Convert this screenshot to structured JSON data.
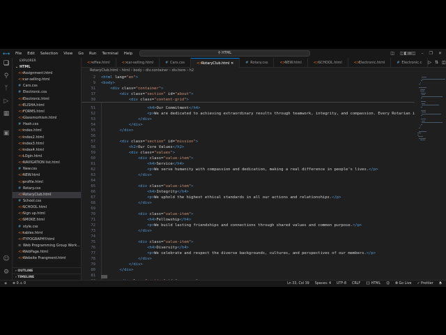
{
  "titlebar": {
    "menus": [
      "File",
      "Edit",
      "Selection",
      "View",
      "Go",
      "Run",
      "Terminal",
      "Help"
    ],
    "search": "HTML"
  },
  "explorer": {
    "header": "EXPLORER",
    "folder": "HTML",
    "files": [
      {
        "name": "Assignment.html",
        "type": "html"
      },
      {
        "name": "car-selling.html",
        "type": "html"
      },
      {
        "name": "Cars.css",
        "type": "css"
      },
      {
        "name": "Electronic.css",
        "type": "css"
      },
      {
        "name": "Electronic.html",
        "type": "html"
      },
      {
        "name": "ELISHA.html",
        "type": "html"
      },
      {
        "name": "FORMS.html",
        "type": "html"
      },
      {
        "name": "Glassmorhism.html",
        "type": "html"
      },
      {
        "name": "Hash.css",
        "type": "css"
      },
      {
        "name": "index.html",
        "type": "html"
      },
      {
        "name": "index2.html",
        "type": "html"
      },
      {
        "name": "index3.html",
        "type": "html"
      },
      {
        "name": "index4.html",
        "type": "html"
      },
      {
        "name": "LOgin.html",
        "type": "html"
      },
      {
        "name": "NAVIGATION list.html",
        "type": "html"
      },
      {
        "name": "New.css",
        "type": "css"
      },
      {
        "name": "NEW.html",
        "type": "html"
      },
      {
        "name": "profile.html",
        "type": "html"
      },
      {
        "name": "Rotary.css",
        "type": "css"
      },
      {
        "name": "RotaryClub.html",
        "type": "html",
        "selected": true
      },
      {
        "name": "School.css",
        "type": "css"
      },
      {
        "name": "SCHOOL.html",
        "type": "html"
      },
      {
        "name": "Sign up.html",
        "type": "html"
      },
      {
        "name": "SMOKE.html",
        "type": "html"
      },
      {
        "name": "style.css",
        "type": "css"
      },
      {
        "name": "tables.html",
        "type": "html"
      },
      {
        "name": "TYPOGRAPHY.html",
        "type": "html"
      },
      {
        "name": "Web Programming Group Work...",
        "type": "doc"
      },
      {
        "name": "WebPage.html",
        "type": "html"
      },
      {
        "name": "Website Frangment.html",
        "type": "html"
      }
    ],
    "sections": [
      "OUTLINE",
      "TIMELINE"
    ]
  },
  "tabs": [
    {
      "label": "offee.html",
      "type": "html"
    },
    {
      "label": "car-selling.html",
      "type": "html"
    },
    {
      "label": "Cars.css",
      "type": "css"
    },
    {
      "label": "RotaryClub.html",
      "type": "html",
      "active": true
    },
    {
      "label": "Rotary.css",
      "type": "css"
    },
    {
      "label": "NEW.html",
      "type": "html"
    },
    {
      "label": "SCHOOL.html",
      "type": "html"
    },
    {
      "label": "Electronic.html",
      "type": "html"
    },
    {
      "label": "Electronic.c",
      "type": "css"
    }
  ],
  "breadcrumb": [
    "RotaryClub.html",
    "html",
    "body",
    "div.container",
    "div.hero",
    "h2"
  ],
  "sticky": [
    {
      "n": 2,
      "text": "<html lang=\"en\">"
    },
    {
      "n": 9,
      "text": "<body>"
    },
    {
      "n": 31,
      "text": "    <div class=\"container\">"
    },
    {
      "n": 37,
      "text": "        <div class=\"section\" id=\"about\">"
    },
    {
      "n": 39,
      "text": "            <div class=\"content-grid\">"
    }
  ],
  "code": [
    {
      "n": 51,
      "text": "                    <h4>Our Commitment</h4>"
    },
    {
      "n": 52,
      "text": "                    <p>We are dedicated to achieving extraordinary results through teamwork, integrity, and compassion. Every Rotarian is co"
    },
    {
      "n": 53,
      "text": "                </div>"
    },
    {
      "n": 54,
      "text": "            </div>"
    },
    {
      "n": 55,
      "text": "        </div>"
    },
    {
      "n": 56,
      "text": ""
    },
    {
      "n": 57,
      "text": "        <div class=\"section\" id=\"mission\">"
    },
    {
      "n": 58,
      "text": "            <h2>Our Core Values</h2>"
    },
    {
      "n": 59,
      "text": "            <div class=\"values\">"
    },
    {
      "n": 60,
      "text": "                <div class=\"value-item\">"
    },
    {
      "n": 61,
      "text": "                    <h4>Service</h4>"
    },
    {
      "n": 62,
      "text": "                    <p>We serve humanity with compassion and dedication, making a real difference in people's lives.</p>"
    },
    {
      "n": 63,
      "text": "                </div>"
    },
    {
      "n": 64,
      "text": ""
    },
    {
      "n": 65,
      "text": "                <div class=\"value-item\">"
    },
    {
      "n": 66,
      "text": "                    <h4>Integrity</h4>"
    },
    {
      "n": 67,
      "text": "                    <p>We uphold the highest ethical standards in all our actions and relationships.</p>"
    },
    {
      "n": 68,
      "text": "                </div>"
    },
    {
      "n": 69,
      "text": ""
    },
    {
      "n": 70,
      "text": "                <div class=\"value-item\">"
    },
    {
      "n": 71,
      "text": "                    <h4>Fellowship</h4>"
    },
    {
      "n": 72,
      "text": "                    <p>We build lasting friendships and connections through shared values and common purpose.</p>"
    },
    {
      "n": 73,
      "text": "                </div>"
    },
    {
      "n": 74,
      "text": ""
    },
    {
      "n": 75,
      "text": "                <div class=\"value-item\">"
    },
    {
      "n": 76,
      "text": "                    <h4>Diversity</h4>"
    },
    {
      "n": 77,
      "text": "                    <p>We celebrate and respect the diverse backgrounds, cultures, and perspectives of our members.</p>"
    },
    {
      "n": 78,
      "text": "                </div>"
    },
    {
      "n": 79,
      "text": "            </div>"
    },
    {
      "n": 80,
      "text": "        </div>"
    },
    {
      "n": 81,
      "text": ""
    },
    {
      "n": 82,
      "text": "        <div class=\"section\" id=\"programs\">"
    }
  ],
  "status": {
    "errors": "0",
    "warnings": "0",
    "position": "Ln 33, Col 39",
    "spaces": "Spaces: 4",
    "encoding": "UTF-8",
    "eol": "CRLF",
    "language": "HTML",
    "golive": "Go Live",
    "prettier": "Prettier"
  },
  "colors": {
    "accent": "#0078d4",
    "html_icon": "#e37933",
    "css_icon": "#519aba"
  }
}
